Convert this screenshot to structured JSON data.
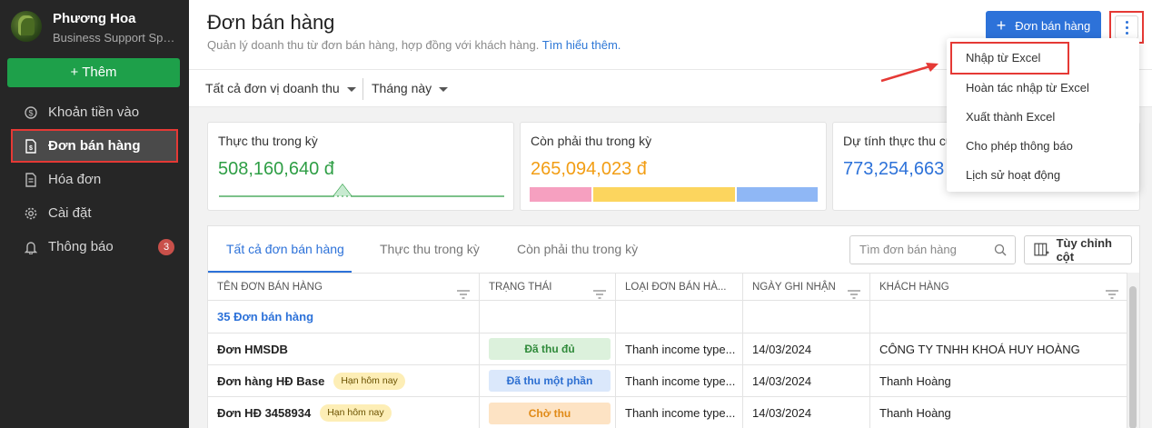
{
  "sidebar": {
    "user_name": "Phương Hoa",
    "user_role": "Business Support Specialist",
    "add_label": "Thêm",
    "items": [
      {
        "label": "Khoản tiền vào",
        "icon": "money-cycle-icon"
      },
      {
        "label": "Đơn bán hàng",
        "icon": "order-doc-icon",
        "active": true
      },
      {
        "label": "Hóa đơn",
        "icon": "invoice-icon"
      },
      {
        "label": "Cài đặt",
        "icon": "gear-icon"
      },
      {
        "label": "Thông báo",
        "icon": "bell-icon",
        "badge": "3"
      }
    ]
  },
  "header": {
    "title": "Đơn bán hàng",
    "subtitle": "Quản lý doanh thu từ đơn bán hàng, hợp đồng với khách hàng.",
    "learn_more": "Tìm hiểu thêm.",
    "primary_button": "Đơn bán hàng"
  },
  "filters": {
    "unit": "Tất cả đơn vị doanh thu",
    "period": "Tháng này"
  },
  "cards": [
    {
      "title": "Thực thu trong kỳ",
      "value": "508,160,640 đ",
      "color": "#2e9e45"
    },
    {
      "title": "Còn phải thu trong kỳ",
      "value": "265,094,023 đ",
      "color": "#f29d13",
      "segments": [
        {
          "share": 0.22,
          "color": "#f6a0c0"
        },
        {
          "share": 0.5,
          "color": "#fcd55e"
        },
        {
          "share": 0.28,
          "color": "#8fb7f5"
        }
      ]
    },
    {
      "title": "Dự tính thực thu cu",
      "value": "773,254,663",
      "color": "#2d72d9"
    }
  ],
  "tabs": [
    "Tất cả đơn bán hàng",
    "Thực thu trong kỳ",
    "Còn phải thu trong kỳ"
  ],
  "search": {
    "placeholder": "Tìm đơn bán hàng"
  },
  "columns_button": "Tùy chỉnh cột",
  "table": {
    "headers": [
      "TÊN ĐƠN BÁN HÀNG",
      "TRẠNG THÁI",
      "LOẠI ĐƠN BÁN HÀ...",
      "NGÀY GHI NHẬN",
      "KHÁCH HÀNG"
    ],
    "group_label": "35 Đơn bán hàng",
    "rows": [
      {
        "name": "Đơn HMSDB",
        "tag": "",
        "status": "Đã thu đủ",
        "status_bg": "#dcf1dc",
        "status_fg": "#2f8a3a",
        "type": "Thanh income type...",
        "date": "14/03/2024",
        "customer": "CÔNG TY TNHH KHOÁ HUY HOÀNG"
      },
      {
        "name": "Đơn hàng HĐ Base",
        "tag": "Hạn hôm nay",
        "status": "Đã thu một phần",
        "status_bg": "#dbe8fb",
        "status_fg": "#2d6fd1",
        "type": "Thanh income type...",
        "date": "14/03/2024",
        "customer": "Thanh Hoàng"
      },
      {
        "name": "Đơn HĐ 3458934",
        "tag": "Hạn hôm nay",
        "status": "Chờ thu",
        "status_bg": "#fde3c4",
        "status_fg": "#e08a17",
        "type": "Thanh income type...",
        "date": "14/03/2024",
        "customer": "Thanh Hoàng"
      }
    ]
  },
  "menu": {
    "items": [
      "Nhập từ Excel",
      "Hoàn tác nhập từ Excel",
      "Xuất thành Excel",
      "Cho phép thông báo",
      "Lịch sử hoạt động"
    ]
  }
}
